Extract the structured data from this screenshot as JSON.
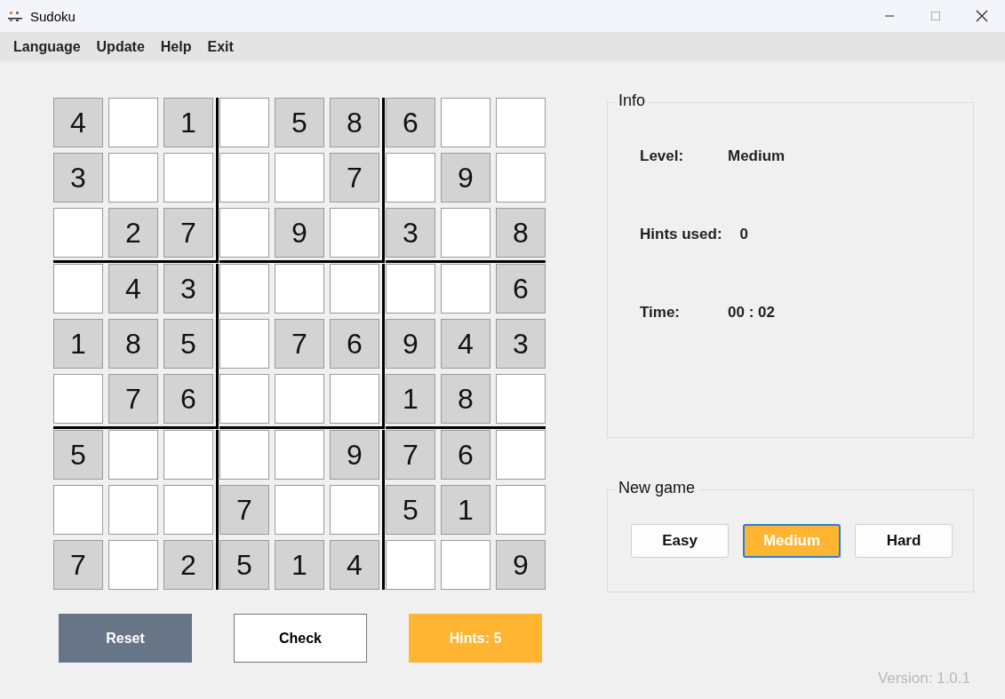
{
  "window": {
    "title": "Sudoku"
  },
  "menu": [
    "Language",
    "Update",
    "Help",
    "Exit"
  ],
  "board": [
    [
      {
        "given": true,
        "value": "4"
      },
      {
        "given": false
      },
      {
        "given": true,
        "value": "1"
      },
      {
        "given": false
      },
      {
        "given": true,
        "value": "5"
      },
      {
        "given": true,
        "value": "8"
      },
      {
        "given": true,
        "value": "6"
      },
      {
        "given": false
      },
      {
        "given": false
      }
    ],
    [
      {
        "given": true,
        "value": "3"
      },
      {
        "given": false
      },
      {
        "given": false
      },
      {
        "given": false
      },
      {
        "given": false
      },
      {
        "given": true,
        "value": "7"
      },
      {
        "given": false
      },
      {
        "given": true,
        "value": "9"
      },
      {
        "given": false
      }
    ],
    [
      {
        "given": false
      },
      {
        "given": true,
        "value": "2"
      },
      {
        "given": true,
        "value": "7"
      },
      {
        "given": false
      },
      {
        "given": true,
        "value": "9"
      },
      {
        "given": false
      },
      {
        "given": true,
        "value": "3"
      },
      {
        "given": false
      },
      {
        "given": true,
        "value": "8"
      }
    ],
    [
      {
        "given": false
      },
      {
        "given": true,
        "value": "4"
      },
      {
        "given": true,
        "value": "3"
      },
      {
        "given": false
      },
      {
        "given": false
      },
      {
        "given": false
      },
      {
        "given": false
      },
      {
        "given": false
      },
      {
        "given": true,
        "value": "6"
      }
    ],
    [
      {
        "given": true,
        "value": "1"
      },
      {
        "given": true,
        "value": "8"
      },
      {
        "given": true,
        "value": "5"
      },
      {
        "given": false
      },
      {
        "given": true,
        "value": "7"
      },
      {
        "given": true,
        "value": "6"
      },
      {
        "given": true,
        "value": "9"
      },
      {
        "given": true,
        "value": "4"
      },
      {
        "given": true,
        "value": "3"
      }
    ],
    [
      {
        "given": false
      },
      {
        "given": true,
        "value": "7"
      },
      {
        "given": true,
        "value": "6"
      },
      {
        "given": false
      },
      {
        "given": false
      },
      {
        "given": false
      },
      {
        "given": true,
        "value": "1"
      },
      {
        "given": true,
        "value": "8"
      },
      {
        "given": false
      }
    ],
    [
      {
        "given": true,
        "value": "5"
      },
      {
        "given": false
      },
      {
        "given": false
      },
      {
        "given": false
      },
      {
        "given": false
      },
      {
        "given": true,
        "value": "9"
      },
      {
        "given": true,
        "value": "7"
      },
      {
        "given": true,
        "value": "6"
      },
      {
        "given": false
      }
    ],
    [
      {
        "given": false
      },
      {
        "given": false
      },
      {
        "given": false
      },
      {
        "given": true,
        "value": "7"
      },
      {
        "given": false
      },
      {
        "given": false
      },
      {
        "given": true,
        "value": "5"
      },
      {
        "given": true,
        "value": "1"
      },
      {
        "given": false
      }
    ],
    [
      {
        "given": true,
        "value": "7"
      },
      {
        "given": false
      },
      {
        "given": true,
        "value": "2"
      },
      {
        "given": true,
        "value": "5"
      },
      {
        "given": true,
        "value": "1"
      },
      {
        "given": true,
        "value": "4"
      },
      {
        "given": false
      },
      {
        "given": false
      },
      {
        "given": true,
        "value": "9"
      }
    ]
  ],
  "actions": [
    {
      "label": "Reset",
      "kind": "reset"
    },
    {
      "label": "Check",
      "kind": "check"
    },
    {
      "label": "Hints: 5",
      "kind": "hints"
    }
  ],
  "info": {
    "title": "Info",
    "rows": [
      {
        "label": "Level:",
        "value": "Medium"
      },
      {
        "label": "Hints used:",
        "value": "0"
      },
      {
        "label": "Time:",
        "value": "00 : 02"
      }
    ]
  },
  "new_game": {
    "title": "New game",
    "levels": [
      {
        "label": "Easy",
        "selected": false
      },
      {
        "label": "Medium",
        "selected": true
      },
      {
        "label": "Hard",
        "selected": false
      }
    ]
  },
  "version": "Version: 1.0.1"
}
